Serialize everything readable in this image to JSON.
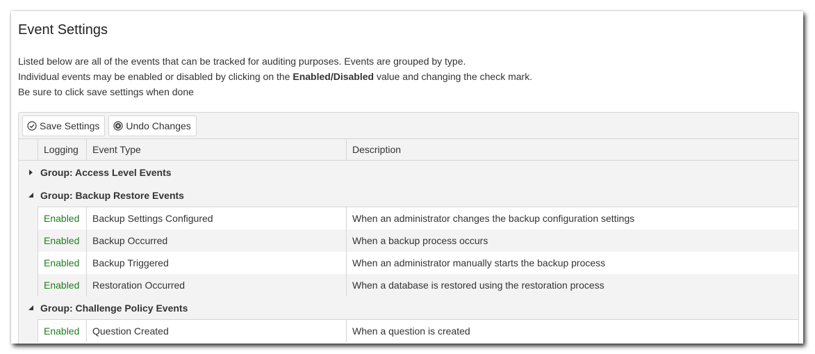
{
  "page": {
    "title": "Event Settings",
    "intro_line1": "Listed below are all of the events that can be tracked for auditing purposes. Events are grouped by type.",
    "intro_line2_prefix": "Individual events may be enabled or disabled by clicking on the ",
    "intro_line2_bold": "Enabled/Disabled",
    "intro_line2_suffix": " value and changing the check mark.",
    "intro_line3": "Be sure to click save settings when done"
  },
  "toolbar": {
    "save_label": "Save Settings",
    "save_icon": "check-circle-icon",
    "undo_label": "Undo Changes",
    "undo_icon": "x-circle-icon"
  },
  "columns": {
    "logging": "Logging",
    "event_type": "Event Type",
    "description": "Description"
  },
  "colors": {
    "enabled": "#1e7d1e",
    "grid_bg": "#f3f3f3",
    "border": "#d5d5d5"
  },
  "groups": [
    {
      "label": "Group: Access Level Events",
      "expanded": false,
      "rows": []
    },
    {
      "label": "Group: Backup Restore Events",
      "expanded": true,
      "rows": [
        {
          "logging": "Enabled",
          "event_type": "Backup Settings Configured",
          "description": "When an administrator changes the backup configuration settings"
        },
        {
          "logging": "Enabled",
          "event_type": "Backup Occurred",
          "description": "When a backup process occurs"
        },
        {
          "logging": "Enabled",
          "event_type": "Backup Triggered",
          "description": "When an administrator manually starts the backup process"
        },
        {
          "logging": "Enabled",
          "event_type": "Restoration Occurred",
          "description": "When a database is restored using the restoration process"
        }
      ]
    },
    {
      "label": "Group: Challenge Policy Events",
      "expanded": true,
      "rows": [
        {
          "logging": "Enabled",
          "event_type": "Question Created",
          "description": "When a question is created"
        }
      ]
    }
  ]
}
